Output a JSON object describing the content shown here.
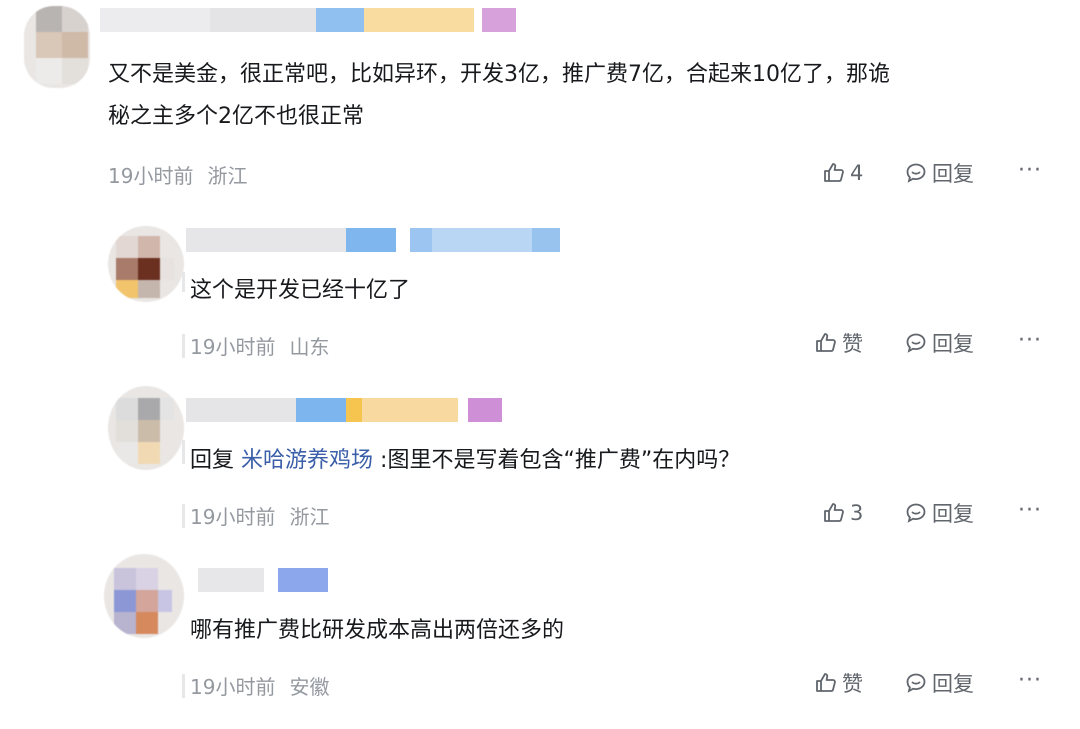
{
  "comments": [
    {
      "text_lines": [
        "又不是美金，很正常吧，比如异环，开发3亿，推广费7亿，合起来10亿了，那诡",
        "秘之主多个2亿不也很正常"
      ],
      "time": "19小时前",
      "location": "浙江",
      "like_label": "4",
      "reply_label": "回复",
      "more_label": "···"
    },
    {
      "text": "这个是开发已经十亿了",
      "time": "19小时前",
      "location": "山东",
      "like_label": "赞",
      "reply_label": "回复",
      "more_label": "···"
    },
    {
      "reply_prefix": "回复",
      "mention": "米哈游养鸡场",
      "reply_text": ":图里不是写着包含“推广费”在内吗？",
      "time": "19小时前",
      "location": "浙江",
      "like_label": "3",
      "reply_label": "回复",
      "more_label": "···"
    },
    {
      "text": "哪有推广费比研发成本高出两倍还多的",
      "time": "19小时前",
      "location": "安徽",
      "like_label": "赞",
      "reply_label": "回复",
      "more_label": "···"
    }
  ],
  "icons": {
    "like": "thumbs-up-icon",
    "reply": "chat-bubble-icon",
    "more": "more-dots-icon"
  },
  "colors": {
    "text": "#17191c",
    "meta": "#9499a0",
    "action": "#61666d",
    "mention": "#3a5fa8"
  }
}
